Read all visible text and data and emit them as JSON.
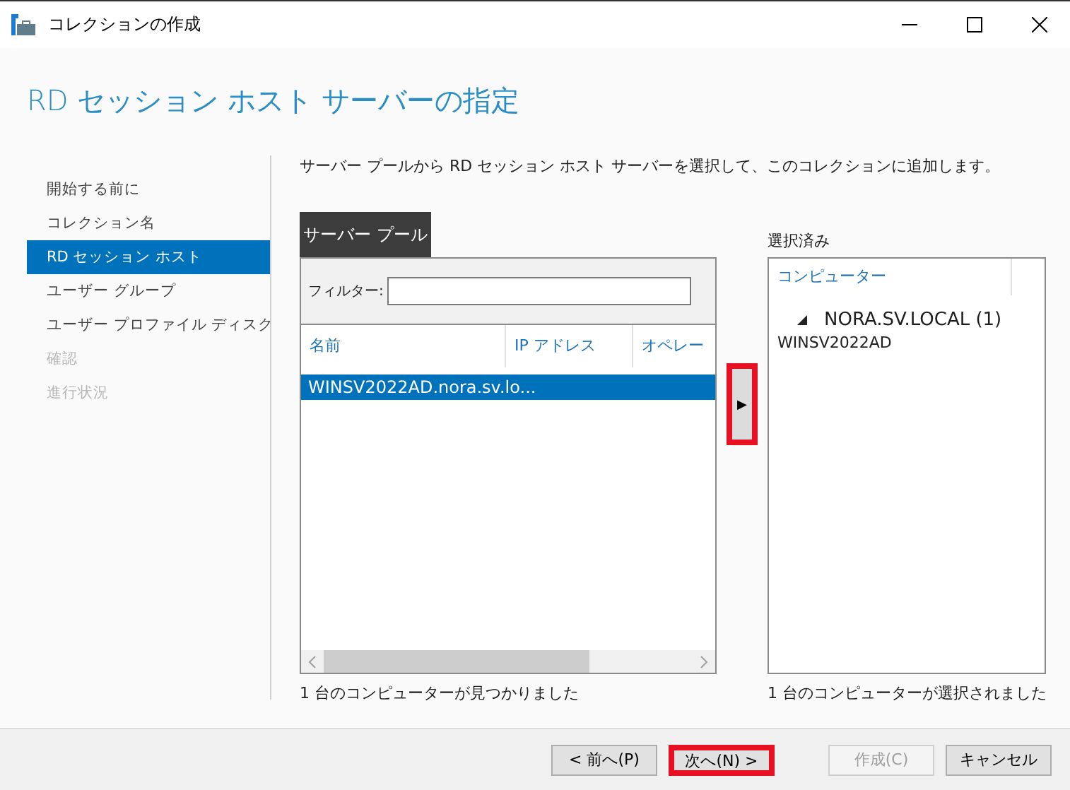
{
  "window": {
    "title": "コレクションの作成"
  },
  "heading": "RD セッション ホスト サーバーの指定",
  "steps": [
    {
      "label": "開始する前に",
      "selected": false,
      "disabled": false
    },
    {
      "label": "コレクション名",
      "selected": false,
      "disabled": false
    },
    {
      "label": "RD セッション ホスト",
      "selected": true,
      "disabled": false
    },
    {
      "label": "ユーザー グループ",
      "selected": false,
      "disabled": false
    },
    {
      "label": "ユーザー プロファイル ディスク",
      "selected": false,
      "disabled": false
    },
    {
      "label": "確認",
      "selected": false,
      "disabled": true
    },
    {
      "label": "進行状況",
      "selected": false,
      "disabled": true
    }
  ],
  "description": "サーバー プールから RD セッション ホスト サーバーを選択して、このコレクションに追加します。",
  "server_pool": {
    "tab": "サーバー プール",
    "filter_label": "フィルター:",
    "columns": [
      "名前",
      "IP アドレス",
      "オペレー"
    ],
    "rows": [
      {
        "name": "WINSV2022AD.nora.sv.lo...",
        "selected": true
      }
    ],
    "status": "1 台のコンピューターが見つかりました"
  },
  "add_button": {
    "label": "▶",
    "highlighted": true
  },
  "selected_panel": {
    "label": "選択済み",
    "column": "コンピューター",
    "groups": [
      {
        "name": "NORA.SV.LOCAL (1)",
        "expanded": true,
        "children": [
          {
            "name": "WINSV2022AD"
          }
        ]
      }
    ],
    "status": "1 台のコンピューターが選択されました"
  },
  "buttons": [
    {
      "label": "< 前へ(P)",
      "disabled": false,
      "highlighted": false
    },
    {
      "label": "次へ(N) >",
      "disabled": false,
      "highlighted": true
    },
    {
      "label": "作成(C)",
      "disabled": true,
      "highlighted": false
    },
    {
      "label": "キャンセル",
      "disabled": false,
      "highlighted": false
    }
  ]
}
